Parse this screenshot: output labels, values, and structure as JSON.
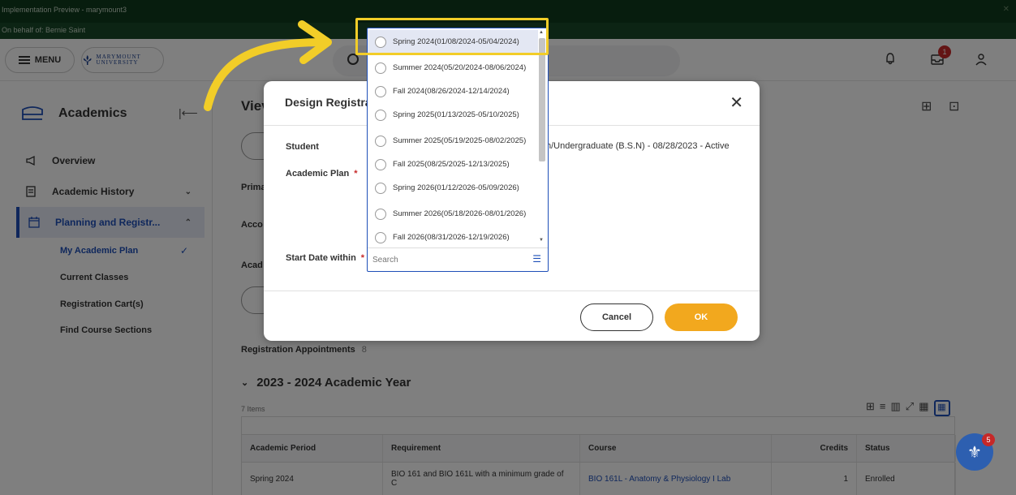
{
  "banner": {
    "line1": "Implementation Preview - marymount3",
    "line2": "On behalf of: Bernie Saint"
  },
  "header": {
    "menu_label": "MENU",
    "logo_text": "MARYMOUNT UNIVERSITY",
    "inbox_badge": "1"
  },
  "sidebar": {
    "title": "Academics",
    "items": [
      {
        "label": "Overview"
      },
      {
        "label": "Academic History"
      },
      {
        "label": "Planning and Registr..."
      }
    ],
    "subitems": [
      {
        "label": "My Academic Plan"
      },
      {
        "label": "Current Classes"
      },
      {
        "label": "Registration Cart(s)"
      },
      {
        "label": "Find Course Sections"
      }
    ]
  },
  "main": {
    "title": "Viev",
    "labels": {
      "primary": "Prima",
      "account": "Acco",
      "academic": "Acad"
    },
    "registration_appointments": "Registration Appointments",
    "registration_appointments_count": "8",
    "year_header": "2023 - 2024 Academic Year",
    "items_count": "7 Items",
    "table": {
      "headers": [
        "Academic Period",
        "Requirement",
        "Course",
        "Credits",
        "Status"
      ],
      "rows": [
        [
          "Spring 2024",
          "BIO 161 and BIO 161L with a minimum grade of C",
          "BIO 161L - Anatomy & Physiology I Lab",
          "1",
          "Enrolled"
        ]
      ]
    }
  },
  "modal": {
    "title": "Design Registra",
    "student_label": "Student",
    "student_value": "h/Undergraduate (B.S.N) - 08/28/2023 - Active",
    "academic_plan_label": "Academic Plan",
    "start_date_label": "Start Date within",
    "required_mark": "*",
    "cancel_label": "Cancel",
    "ok_label": "OK"
  },
  "dropdown": {
    "options": [
      {
        "label": "Spring 2024(01/08/2024-05/04/2024)"
      },
      {
        "label": "Summer 2024(05/20/2024-08/06/2024)"
      },
      {
        "label": "Fall 2024(08/26/2024-12/14/2024)"
      },
      {
        "label": "Spring 2025(01/13/2025-05/10/2025)"
      },
      {
        "label": "Summer 2025(05/19/2025-08/02/2025)"
      },
      {
        "label": "Fall 2025(08/25/2025-12/13/2025)"
      },
      {
        "label": "Spring 2026(01/12/2026-05/09/2026)"
      },
      {
        "label": "Summer 2026(05/18/2026-08/01/2026)"
      },
      {
        "label": "Fall 2026(08/31/2026-12/19/2026)"
      }
    ],
    "search_placeholder": "Search"
  },
  "help": {
    "badge": "5"
  },
  "colors": {
    "accent_blue": "#1e4fb8",
    "ok_orange": "#f2a81e",
    "highlight_yellow": "#f2cd28",
    "banner_green": "#0e3a1c"
  }
}
